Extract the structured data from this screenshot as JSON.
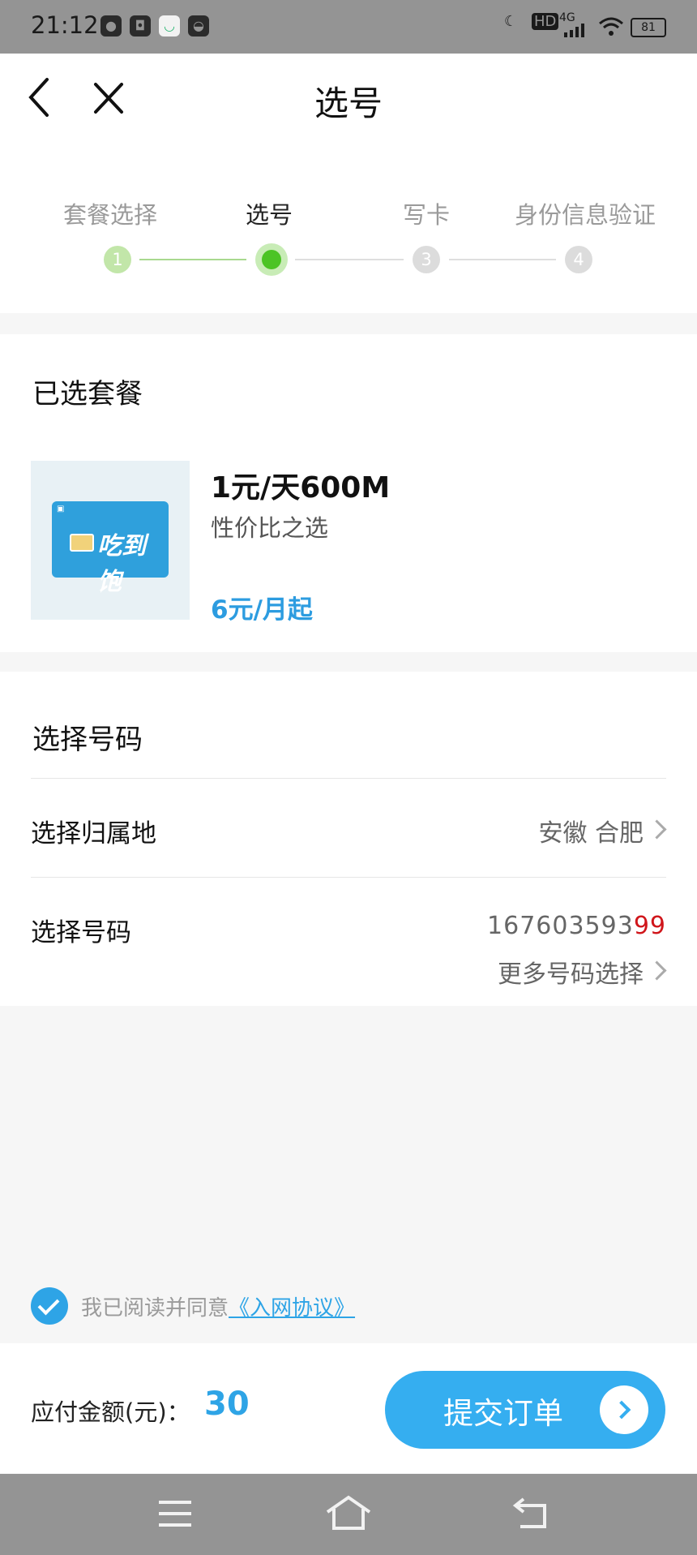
{
  "status_bar": {
    "time": "21:12",
    "left_icons": [
      "wechat-icon",
      "app-icon",
      "message-icon",
      "bag-icon"
    ],
    "network": "4G",
    "hd": "HD",
    "battery": "81"
  },
  "header": {
    "title": "选号",
    "back_icon": "chevron-left-icon",
    "close_icon": "close-icon"
  },
  "steps": [
    {
      "label": "套餐选择",
      "number": "1",
      "state": "done"
    },
    {
      "label": "选号",
      "number": "2",
      "state": "active"
    },
    {
      "label": "写卡",
      "number": "3",
      "state": "pending"
    },
    {
      "label": "身份信息验证",
      "number": "4",
      "state": "pending"
    }
  ],
  "package": {
    "section_title": "已选套餐",
    "name": "1元/天600M",
    "desc": "性价比之选",
    "price": "6元/月起",
    "card_text": "吃到饱"
  },
  "number_section": {
    "title": "选择号码",
    "location_label": "选择归属地",
    "location_value": "安徽 合肥",
    "number_label": "选择号码",
    "number_main": "167603593",
    "number_highlight": "99",
    "more_label": "更多号码选择"
  },
  "agreement": {
    "checked": true,
    "text": "我已阅读并同意",
    "link": "《入网协议》"
  },
  "order": {
    "pay_label": "应付金额(元)：",
    "amount": "30",
    "submit_label": "提交订单"
  },
  "colors": {
    "accent": "#35aef0",
    "active_step": "#4cc425",
    "highlight_digits": "#d0161b"
  }
}
